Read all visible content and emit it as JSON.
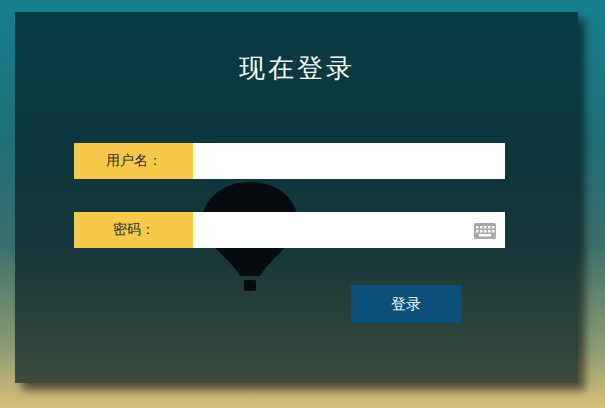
{
  "title": "现在登录",
  "fields": [
    {
      "label": "用户名："
    },
    {
      "label": "密码："
    }
  ],
  "button": "登录"
}
